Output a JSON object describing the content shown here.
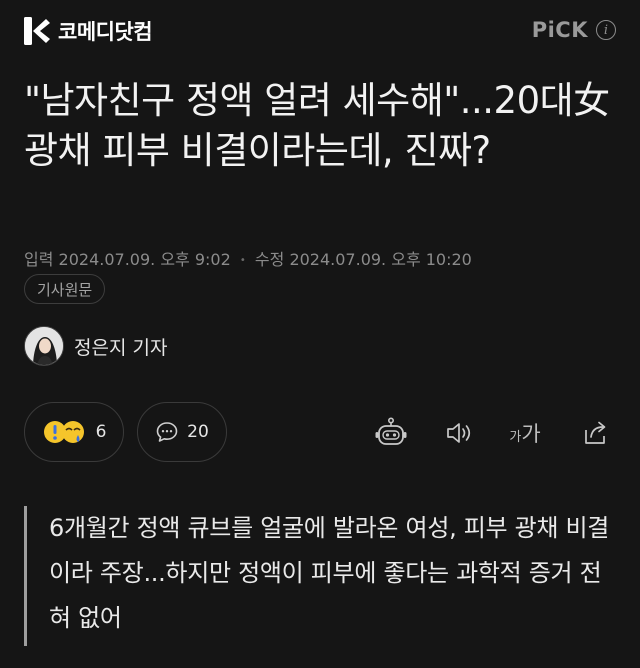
{
  "header": {
    "brand_name": "코메디닷컴",
    "pick_label": "PiCK",
    "info_icon": "info-icon"
  },
  "article": {
    "headline": "\"남자친구 정액 얼려 세수해\"...20대女 광채 피부 비결이라는데, 진짜?",
    "meta": {
      "published_label": "입력",
      "published_value": "2024.07.09. 오후 9:02",
      "separator": "•",
      "modified_label": "수정",
      "modified_value": "2024.07.09. 오후 10:20"
    },
    "source_chip": "기사원문",
    "reporter": "정은지 기자",
    "summary": "6개월간 정액 큐브를 얼굴에 발라온 여성, 피부 광채 비결이라 주장...하지만 정액이 피부에 좋다는 과학적 증거 전혀 없어"
  },
  "actions": {
    "reaction_count": "6",
    "comment_count": "20",
    "font_small": "가",
    "font_large": "가",
    "icons": [
      "reaction-emoji-icon",
      "comment-bubble-icon",
      "robot-summary-icon",
      "audio-speaker-icon",
      "font-size-icon",
      "share-icon"
    ]
  },
  "colors": {
    "background": "#151515",
    "text_primary": "#f2f2f2",
    "text_secondary": "#8b8b8b",
    "border": "#3a3a3a",
    "reaction_yellow": "#f5c52b",
    "reaction_blue": "#3c6fe0"
  }
}
